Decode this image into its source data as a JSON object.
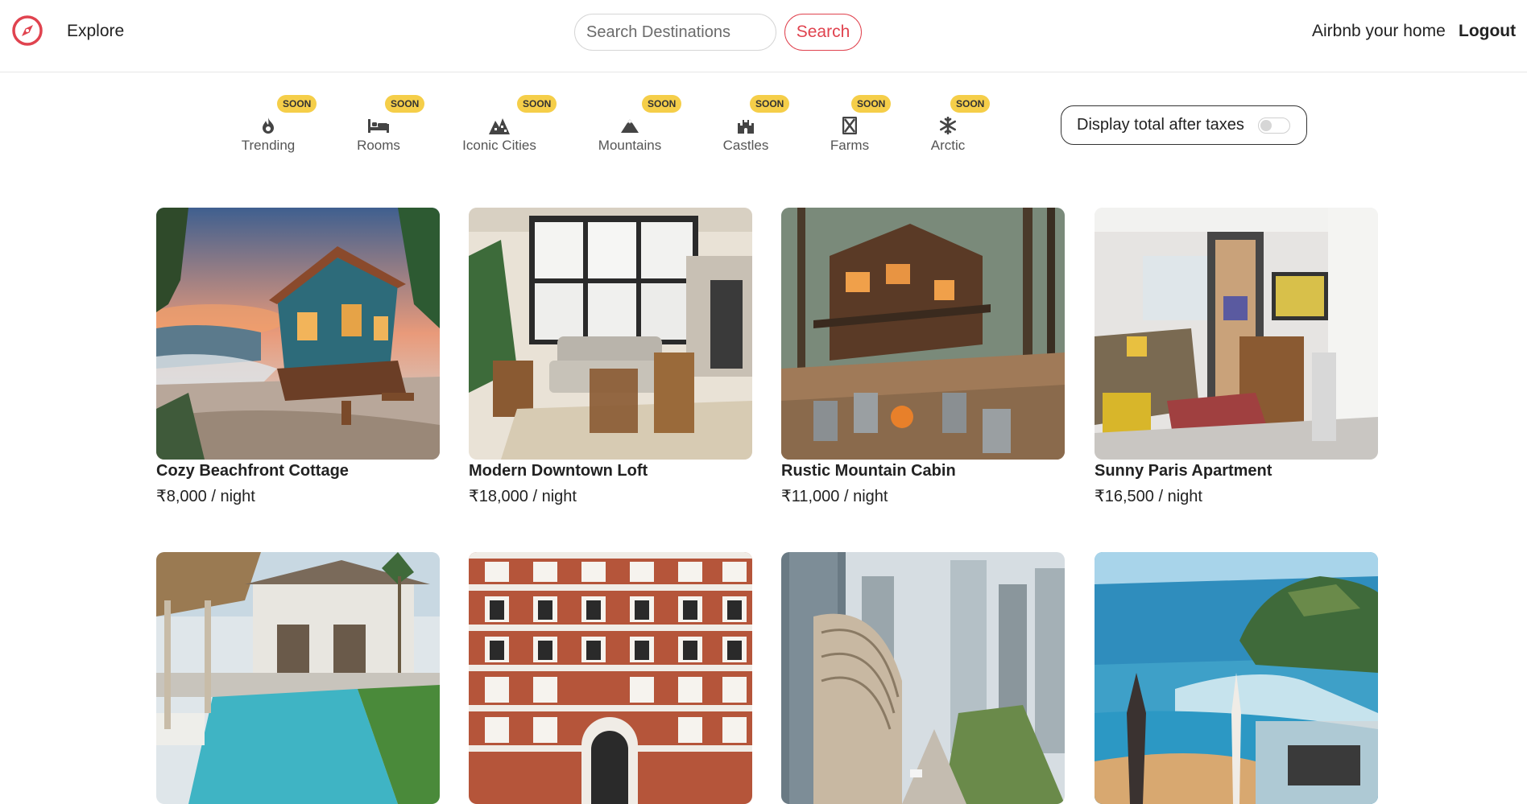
{
  "navbar": {
    "explore_label": "Explore",
    "search_placeholder": "Search Destinations",
    "search_button": "Search",
    "host_label": "Airbnb your home",
    "logout_label": "Logout",
    "brand_color": "#e0434f"
  },
  "filters": [
    {
      "label": "Trending",
      "badge": "SOON",
      "icon": "fire-icon"
    },
    {
      "label": "Rooms",
      "badge": "SOON",
      "icon": "bed-icon"
    },
    {
      "label": "Iconic Cities",
      "badge": "SOON",
      "icon": "city-icon"
    },
    {
      "label": "Mountains",
      "badge": "SOON",
      "icon": "mountain-icon"
    },
    {
      "label": "Castles",
      "badge": "SOON",
      "icon": "castle-icon"
    },
    {
      "label": "Farms",
      "badge": "SOON",
      "icon": "farm-icon"
    },
    {
      "label": "Arctic",
      "badge": "SOON",
      "icon": "snowflake-icon"
    }
  ],
  "tax_toggle": {
    "label": "Display total after taxes",
    "enabled": false
  },
  "badge_color": "#f5ce49",
  "listings": [
    {
      "title": "Cozy Beachfront Cottage",
      "currency": "₹",
      "price": "8,000",
      "unit": " / night"
    },
    {
      "title": "Modern Downtown Loft",
      "currency": "₹",
      "price": "18,000",
      "unit": " / night"
    },
    {
      "title": "Rustic Mountain Cabin",
      "currency": "₹",
      "price": "11,000",
      "unit": " / night"
    },
    {
      "title": "Sunny Paris Apartment",
      "currency": "₹",
      "price": "16,500",
      "unit": " / night"
    },
    {
      "title": "",
      "currency": "",
      "price": "",
      "unit": ""
    },
    {
      "title": "",
      "currency": "",
      "price": "",
      "unit": ""
    },
    {
      "title": "",
      "currency": "",
      "price": "",
      "unit": ""
    },
    {
      "title": "",
      "currency": "",
      "price": "",
      "unit": ""
    }
  ]
}
